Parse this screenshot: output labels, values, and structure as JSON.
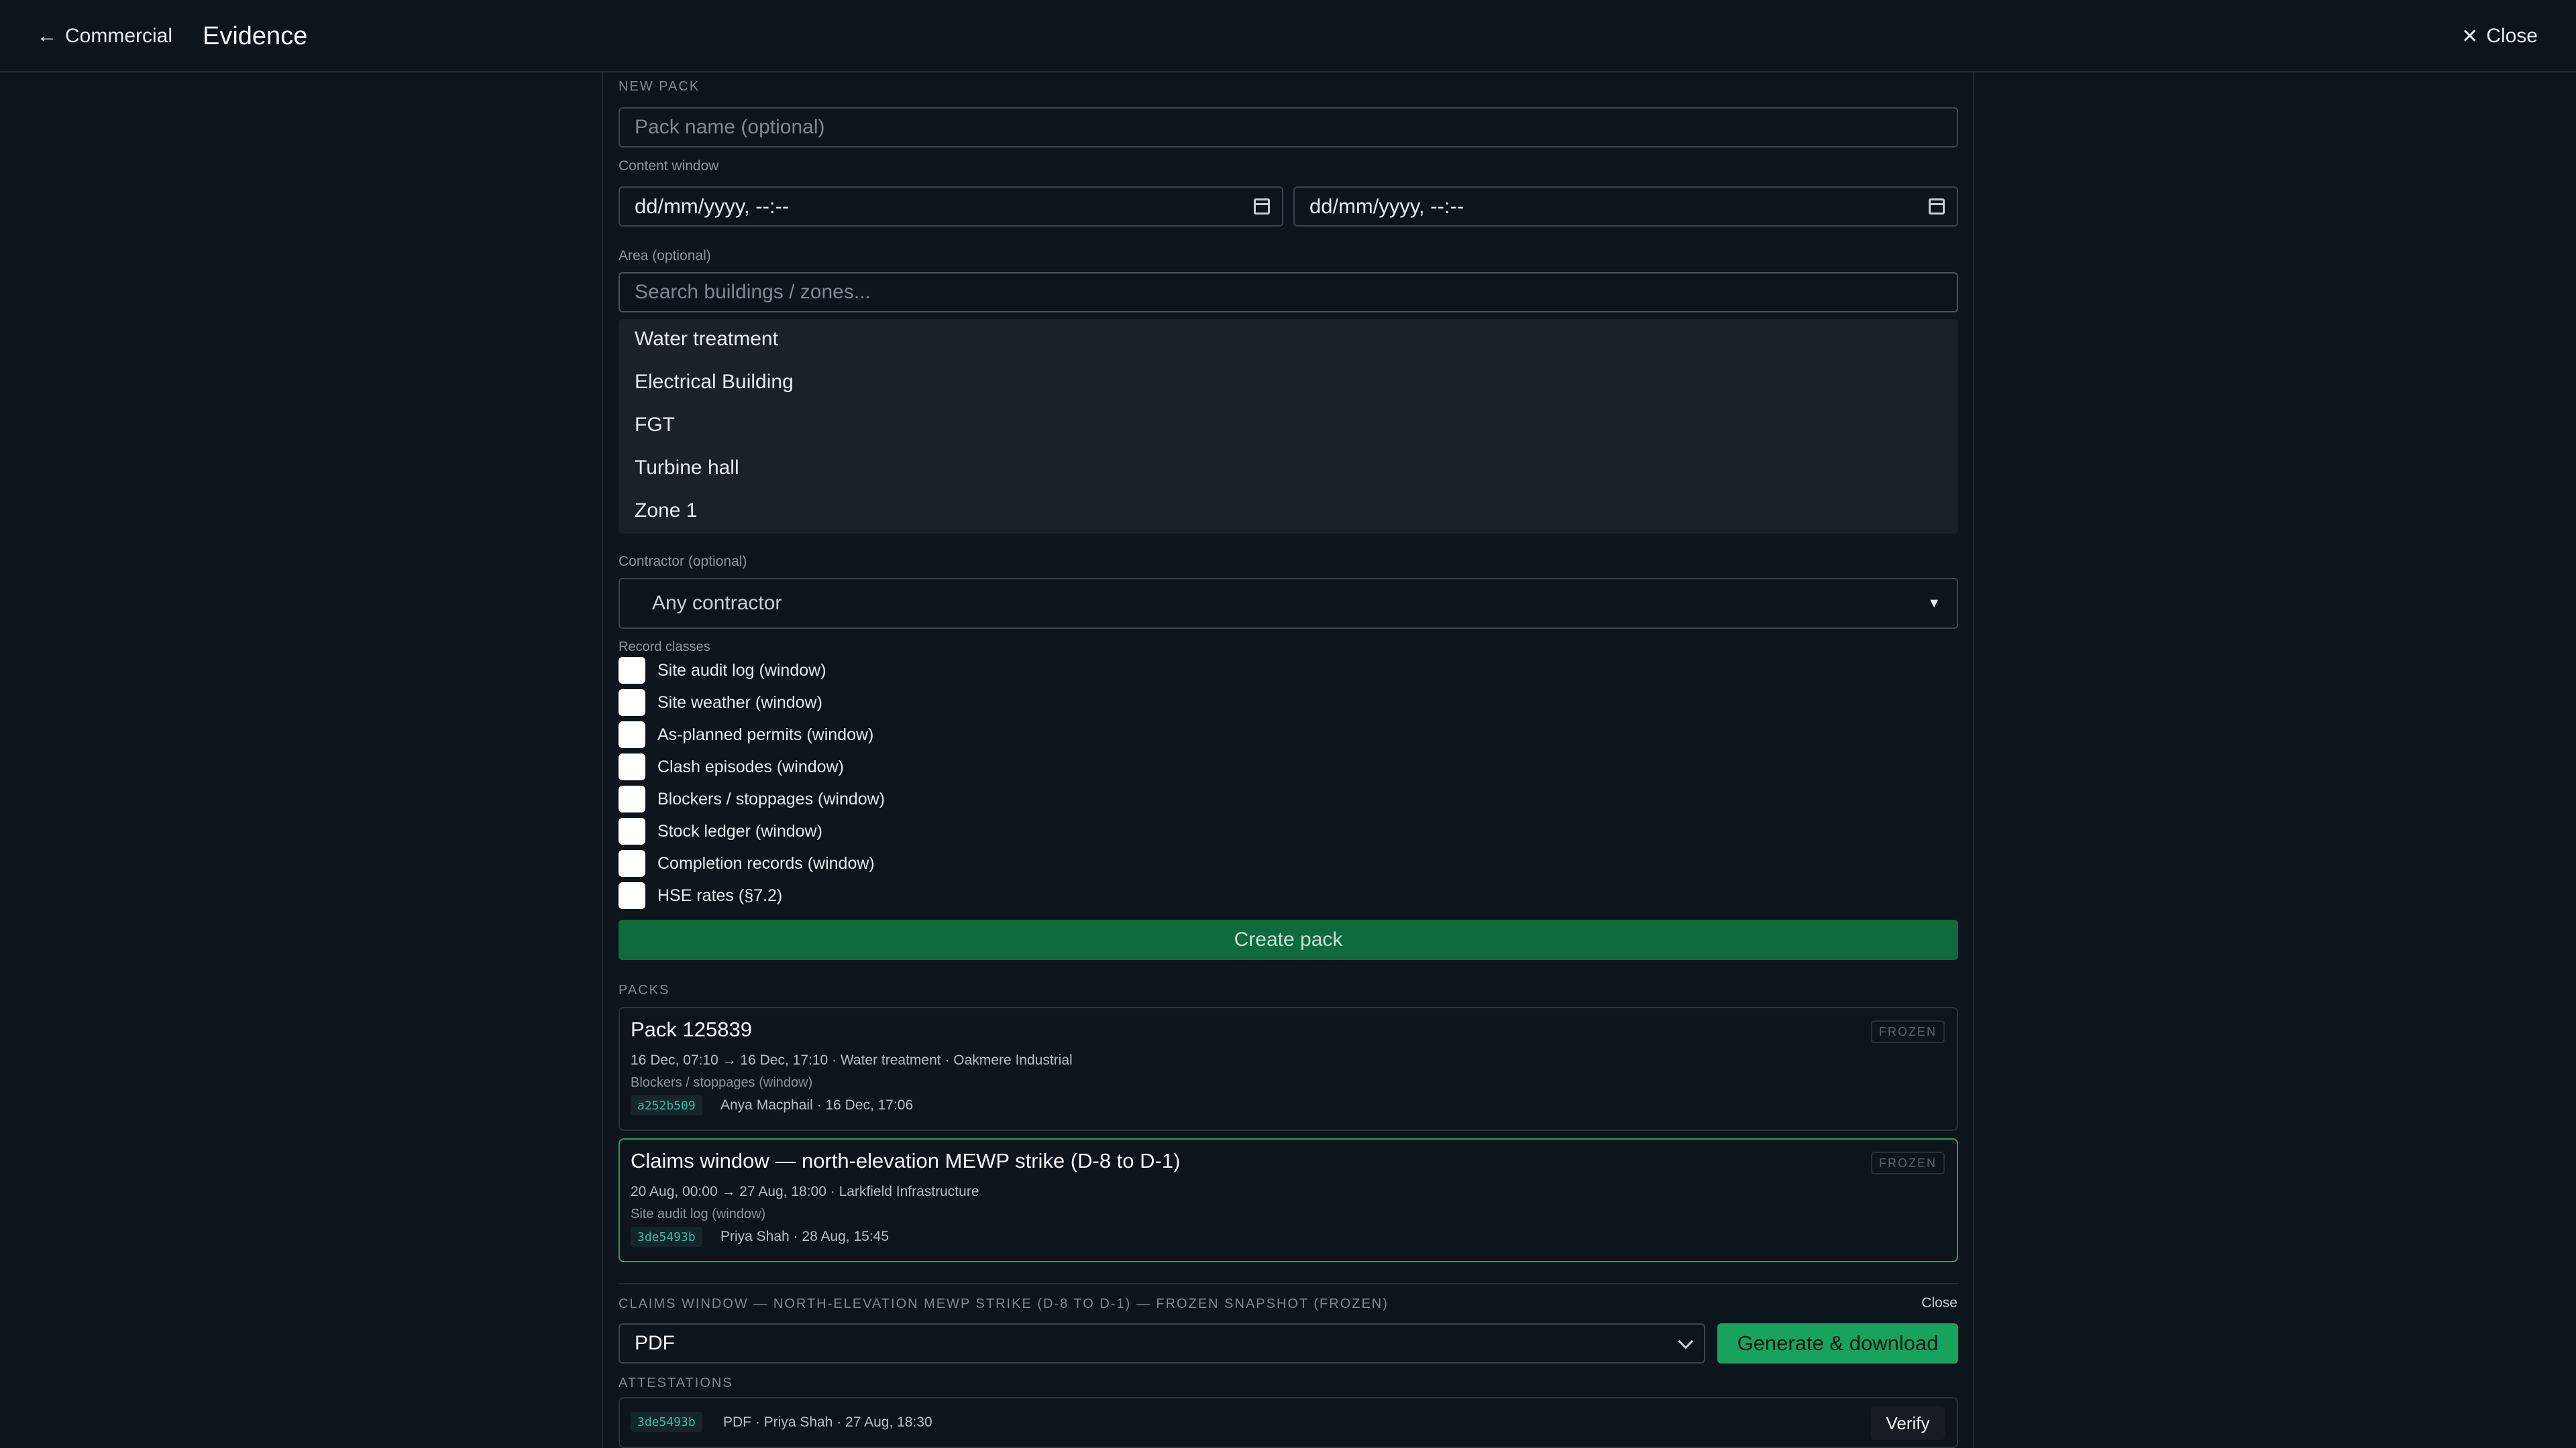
{
  "topbar": {
    "back_label": "Commercial",
    "title": "Evidence",
    "close_label": "Close"
  },
  "new_pack": {
    "section_label": "NEW PACK",
    "name_placeholder": "Pack name (optional)",
    "content_window_label": "Content window",
    "start_value": "dd/mm/yyyy, --:--",
    "end_value": "dd/mm/yyyy, --:--",
    "area_label": "Area (optional)",
    "area_placeholder": "Search buildings / zones...",
    "area_options": [
      "Water treatment",
      "Electrical Building",
      "FGT",
      "Turbine hall",
      "Zone 1"
    ],
    "contractor_label": "Contractor (optional)",
    "contractor_value": "Any contractor",
    "record_classes_label": "Record classes",
    "record_classes": [
      "Site audit log (window)",
      "Site weather (window)",
      "As-planned permits (window)",
      "Clash episodes (window)",
      "Blockers / stoppages (window)",
      "Stock ledger (window)",
      "Completion records (window)",
      "HSE rates (§7.2)"
    ],
    "create_label": "Create pack"
  },
  "packs": {
    "section_label": "PACKS",
    "items": [
      {
        "title": "Pack 125839",
        "meta": "16 Dec, 07:10 → 16 Dec, 17:10 · Water treatment · Oakmere Industrial",
        "classes": "Blockers / stoppages (window)",
        "hash": "a252b509",
        "author": "Anya Macphail · 16 Dec, 17:06",
        "status": "FROZEN"
      },
      {
        "title": "Claims window — north-elevation MEWP strike (D-8 to D-1)",
        "meta": "20 Aug, 00:00 → 27 Aug, 18:00 · Larkfield Infrastructure",
        "classes": "Site audit log (window)",
        "hash": "3de5493b",
        "author": "Priya Shah · 28 Aug, 15:45",
        "status": "FROZEN"
      }
    ]
  },
  "snapshot": {
    "label": "CLAIMS WINDOW — NORTH-ELEVATION MEWP STRIKE (D-8 TO D-1) — FROZEN SNAPSHOT (FROZEN)",
    "close_label": "Close",
    "format_value": "PDF",
    "generate_label": "Generate & download",
    "attestations_label": "ATTESTATIONS",
    "attestation": {
      "hash": "3de5493b",
      "meta": "PDF · Priya Shah · 27 Aug, 18:30",
      "verify_label": "Verify"
    }
  }
}
